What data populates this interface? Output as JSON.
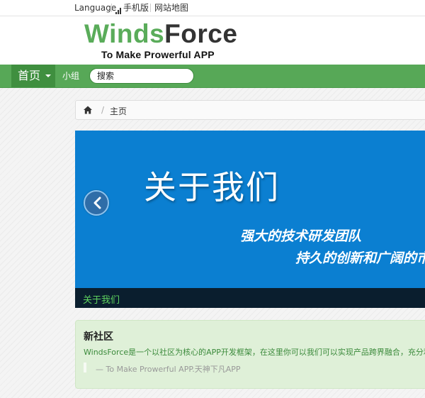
{
  "topbar": {
    "language": "Language",
    "mobile": "手机版",
    "sitemap": "网站地图"
  },
  "logo": {
    "part1": "Winds",
    "part2": "Force",
    "tagline": "To Make Prowerful APP"
  },
  "nav": {
    "home": "首页",
    "group": "小组",
    "search_placeholder": "搜索"
  },
  "breadcrumb": {
    "separator": "/",
    "current": "主页"
  },
  "carousel": {
    "title": "关于我们",
    "line1": "强大的技术研发团队",
    "line2": "持久的创新和广阔的市",
    "caption": "关于我们"
  },
  "community": {
    "title": "新社区",
    "description": "WindsForce是一个以社区为核心的APP开发框架，在这里你可以我们可以实现产品跨界融合，充分利用",
    "quote": "— To Make Prowerful APP.天神下凡APP"
  },
  "colors": {
    "brand_green": "#5aac5a",
    "nav_green": "#57a857",
    "carousel_blue": "#0b7fd1",
    "caption_green": "#5fd35f"
  }
}
